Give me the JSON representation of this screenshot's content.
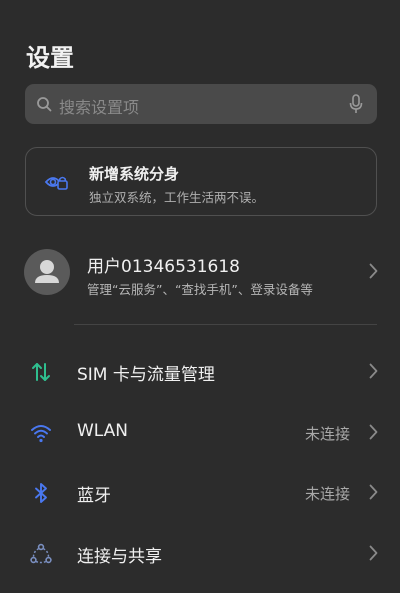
{
  "header": {
    "title": "设置"
  },
  "search": {
    "placeholder": "搜索设置项",
    "icon": "search-icon",
    "mic_icon": "microphone-icon"
  },
  "promo": {
    "title": "新增系统分身",
    "subtitle": "独立双系统，工作生活两不误。",
    "icon": "system-clone-icon"
  },
  "account": {
    "name": "用户01346531618",
    "subtitle": "管理“云服务”、“查找手机”、登录设备等",
    "icon": "avatar-person-icon"
  },
  "settings": [
    {
      "label": "SIM 卡与流量管理",
      "status": "",
      "icon": "sim-data-icon"
    },
    {
      "label": "WLAN",
      "status": "未连接",
      "icon": "wifi-icon"
    },
    {
      "label": "蓝牙",
      "status": "未连接",
      "icon": "bluetooth-icon"
    },
    {
      "label": "连接与共享",
      "status": "",
      "icon": "connection-share-icon"
    }
  ],
  "colors": {
    "background": "#2c2c2c",
    "search_bg": "#4a4a4a",
    "accent_blue": "#4a78f0",
    "accent_green": "#2fbf8f"
  }
}
